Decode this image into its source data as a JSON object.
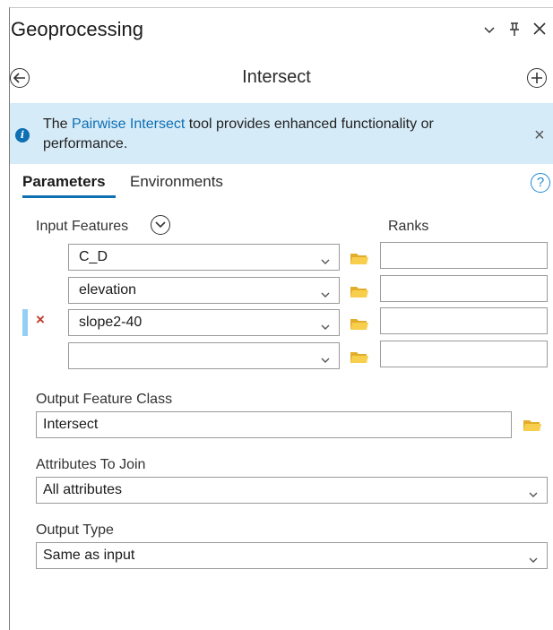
{
  "pane": {
    "title": "Geoprocessing",
    "controls": {
      "menu": "⌄",
      "pin": "ᵽ",
      "close": "×"
    }
  },
  "tool": {
    "title": "Intersect",
    "back_icon": "arrow-left-circle",
    "add_icon": "plus-circle"
  },
  "banner": {
    "text_before": "The ",
    "link": "Pairwise Intersect",
    "text_after": " tool provides enhanced functionality or performance.",
    "info_icon": "i",
    "close": "×"
  },
  "tabs": {
    "parameters": "Parameters",
    "environments": "Environments",
    "help": "?"
  },
  "input_features": {
    "label": "Input Features",
    "ranks_label": "Ranks",
    "rows": [
      {
        "value": "C_D",
        "rank": ""
      },
      {
        "value": "elevation",
        "rank": ""
      },
      {
        "value": "slope2-40",
        "rank": ""
      },
      {
        "value": "",
        "rank": ""
      }
    ],
    "remove_mark": "×"
  },
  "output_feature_class": {
    "label": "Output Feature Class",
    "value": "Intersect"
  },
  "attributes_to_join": {
    "label": "Attributes To Join",
    "value": "All attributes"
  },
  "output_type": {
    "label": "Output Type",
    "value": "Same as input"
  },
  "colors": {
    "accent": "#0e6fb3",
    "banner_bg": "#d6ebf8",
    "folder": "#f0c23b",
    "remove": "#c0392b",
    "selected_row_bar": "#92d0f3"
  }
}
